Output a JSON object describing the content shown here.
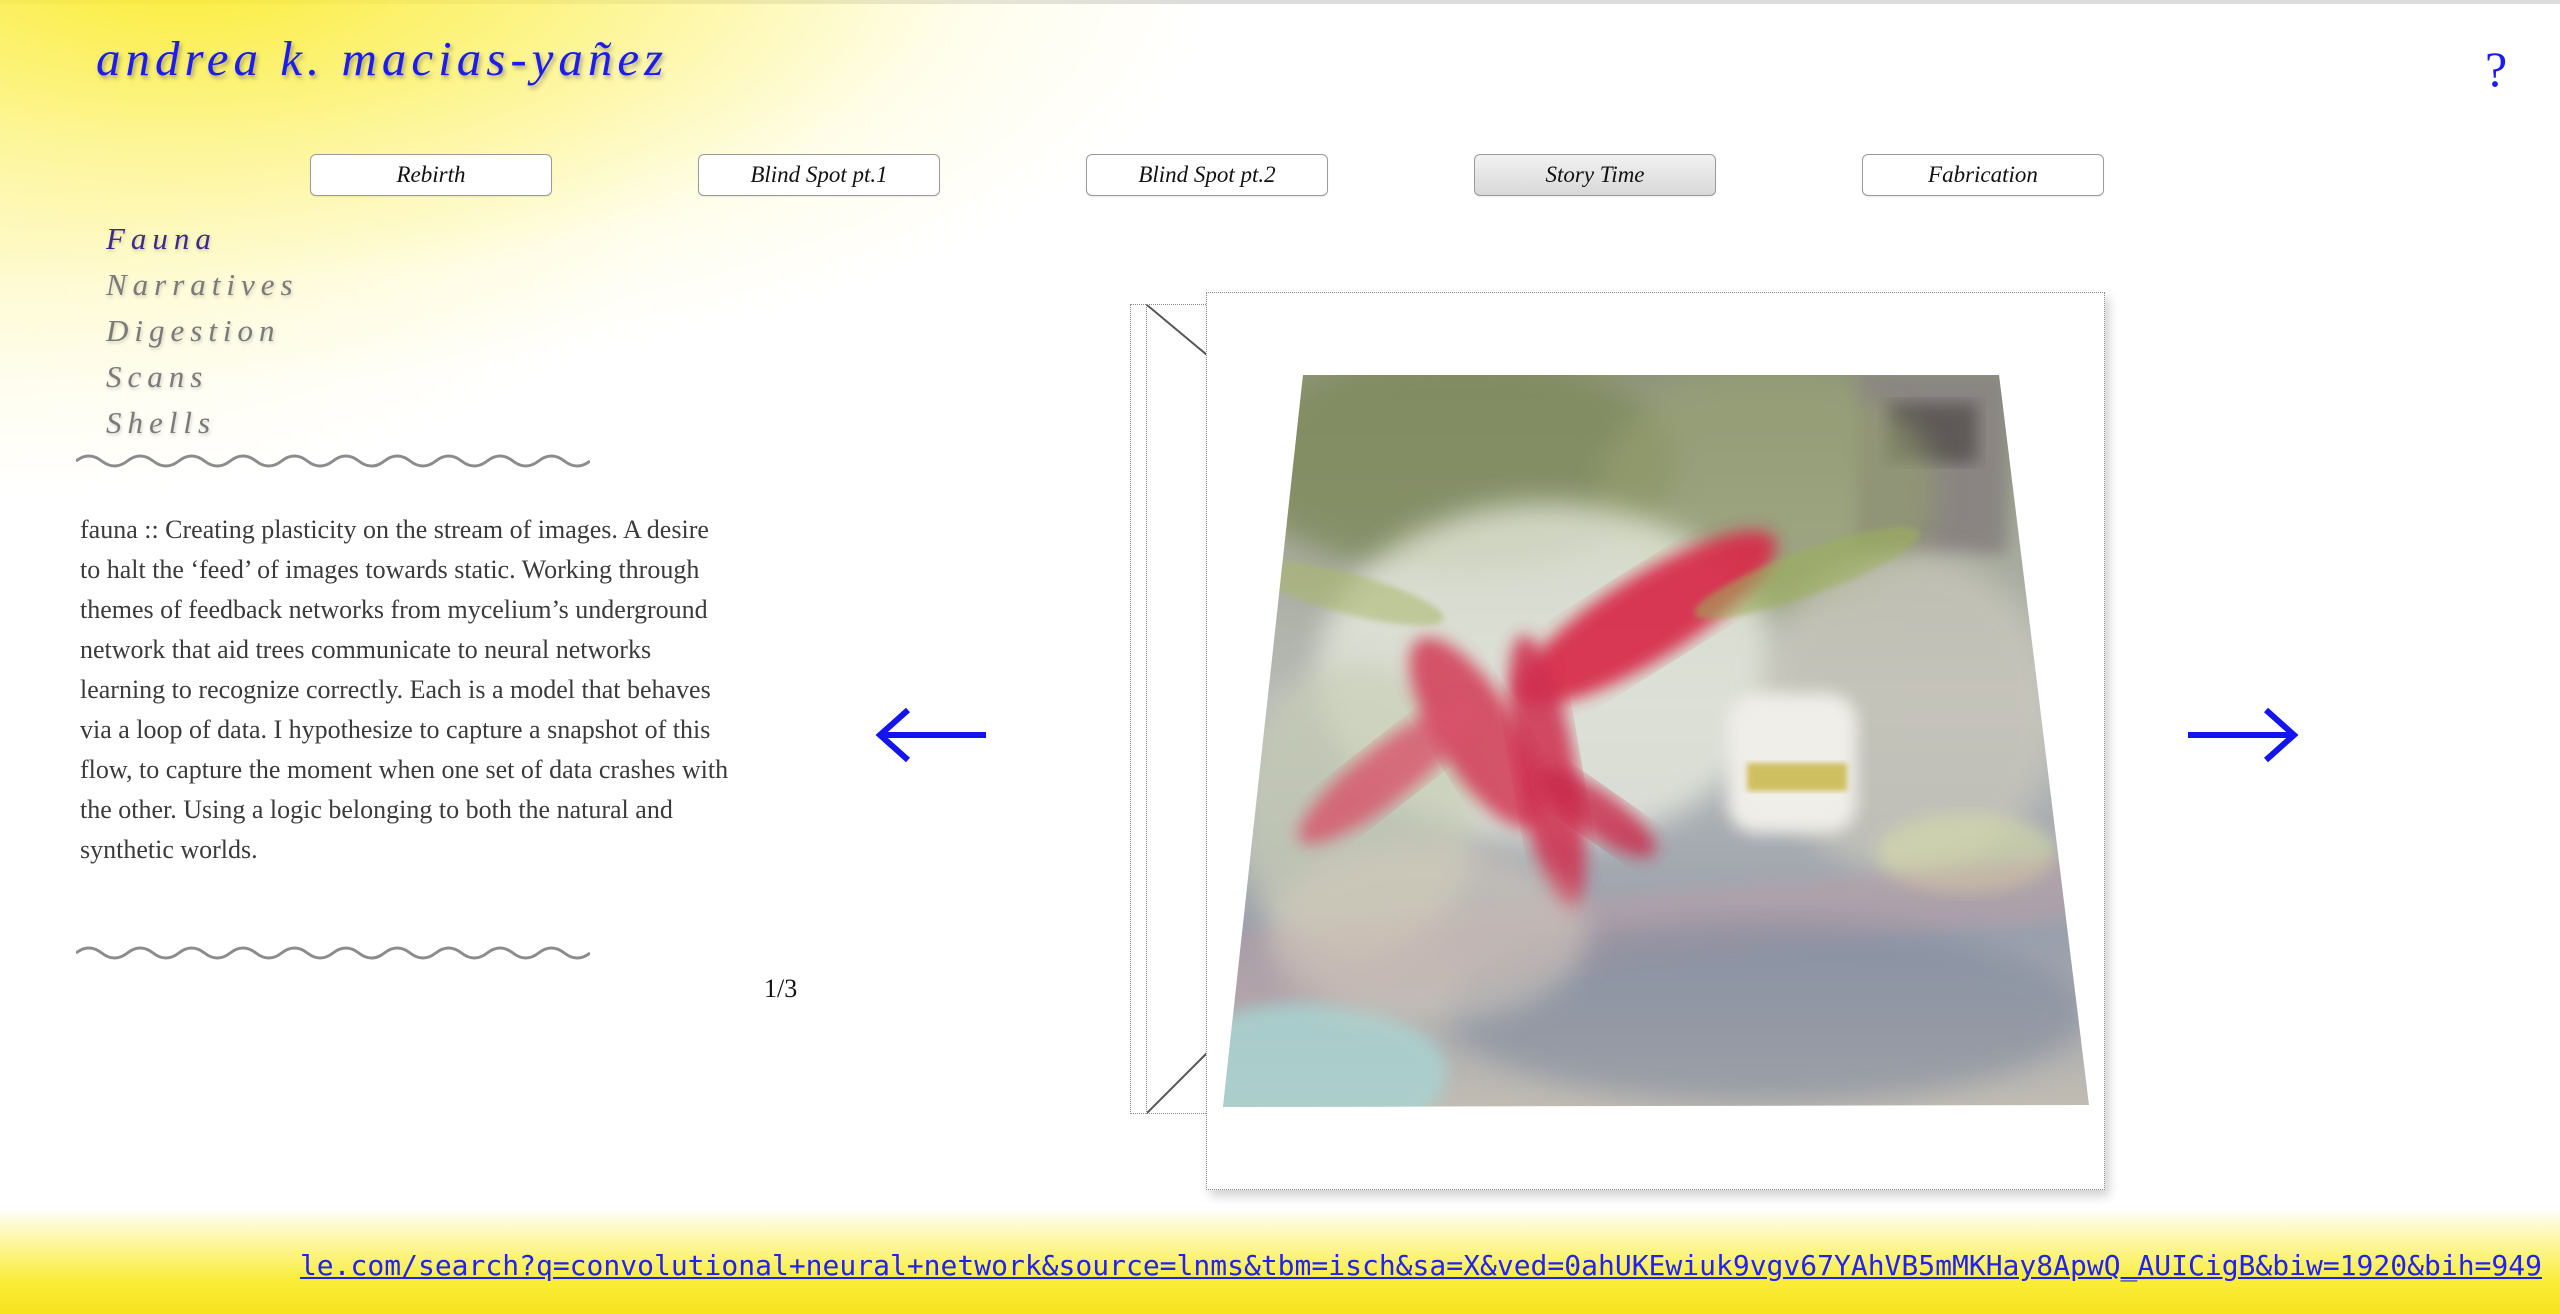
{
  "header": {
    "site_title": "andrea k. macias-yañez",
    "help_label": "?"
  },
  "tabs": [
    {
      "label": "Rebirth",
      "active": false
    },
    {
      "label": "Blind Spot pt.1",
      "active": false
    },
    {
      "label": "Blind Spot pt.2",
      "active": false
    },
    {
      "label": "Story Time",
      "active": true
    },
    {
      "label": "Fabrication",
      "active": false
    }
  ],
  "subnav": {
    "items": [
      {
        "label": "Fauna",
        "active": true
      },
      {
        "label": "Narratives",
        "active": false
      },
      {
        "label": "Digestion",
        "active": false
      },
      {
        "label": "Scans",
        "active": false
      },
      {
        "label": "Shells",
        "active": false
      }
    ]
  },
  "description": "fauna :: Creating plasticity on the stream of images. A desire to halt the ‘feed’ of images towards static. Working through themes of feedback networks from mycelium’s underground network that aid trees communicate to neural networks learning to recognize correctly. Each is a model that behaves via a loop of data. I hypothesize to capture a snapshot of this flow, to capture the moment when one set of data crashes with the other. Using a logic belonging to both the natural and synthetic worlds.",
  "gallery": {
    "counter": "1/3",
    "prev_icon": "arrow-left-icon",
    "next_icon": "arrow-right-icon"
  },
  "status_bar": {
    "url": "le.com/search?q=convolutional+neural+network&source=lnms&tbm=isch&sa=X&ved=0ahUKEwiuk9vgv67YAhVB5mMKHay8ApwQ_AUICigB&biw=1920&bih=949"
  },
  "colors": {
    "title_blue": "#1c1cf0",
    "arrow_blue": "#1414ee",
    "glow_yellow": "#faeb28",
    "subnav_active": "#3e2a8a",
    "subnav_inactive": "#7a7a7a"
  }
}
